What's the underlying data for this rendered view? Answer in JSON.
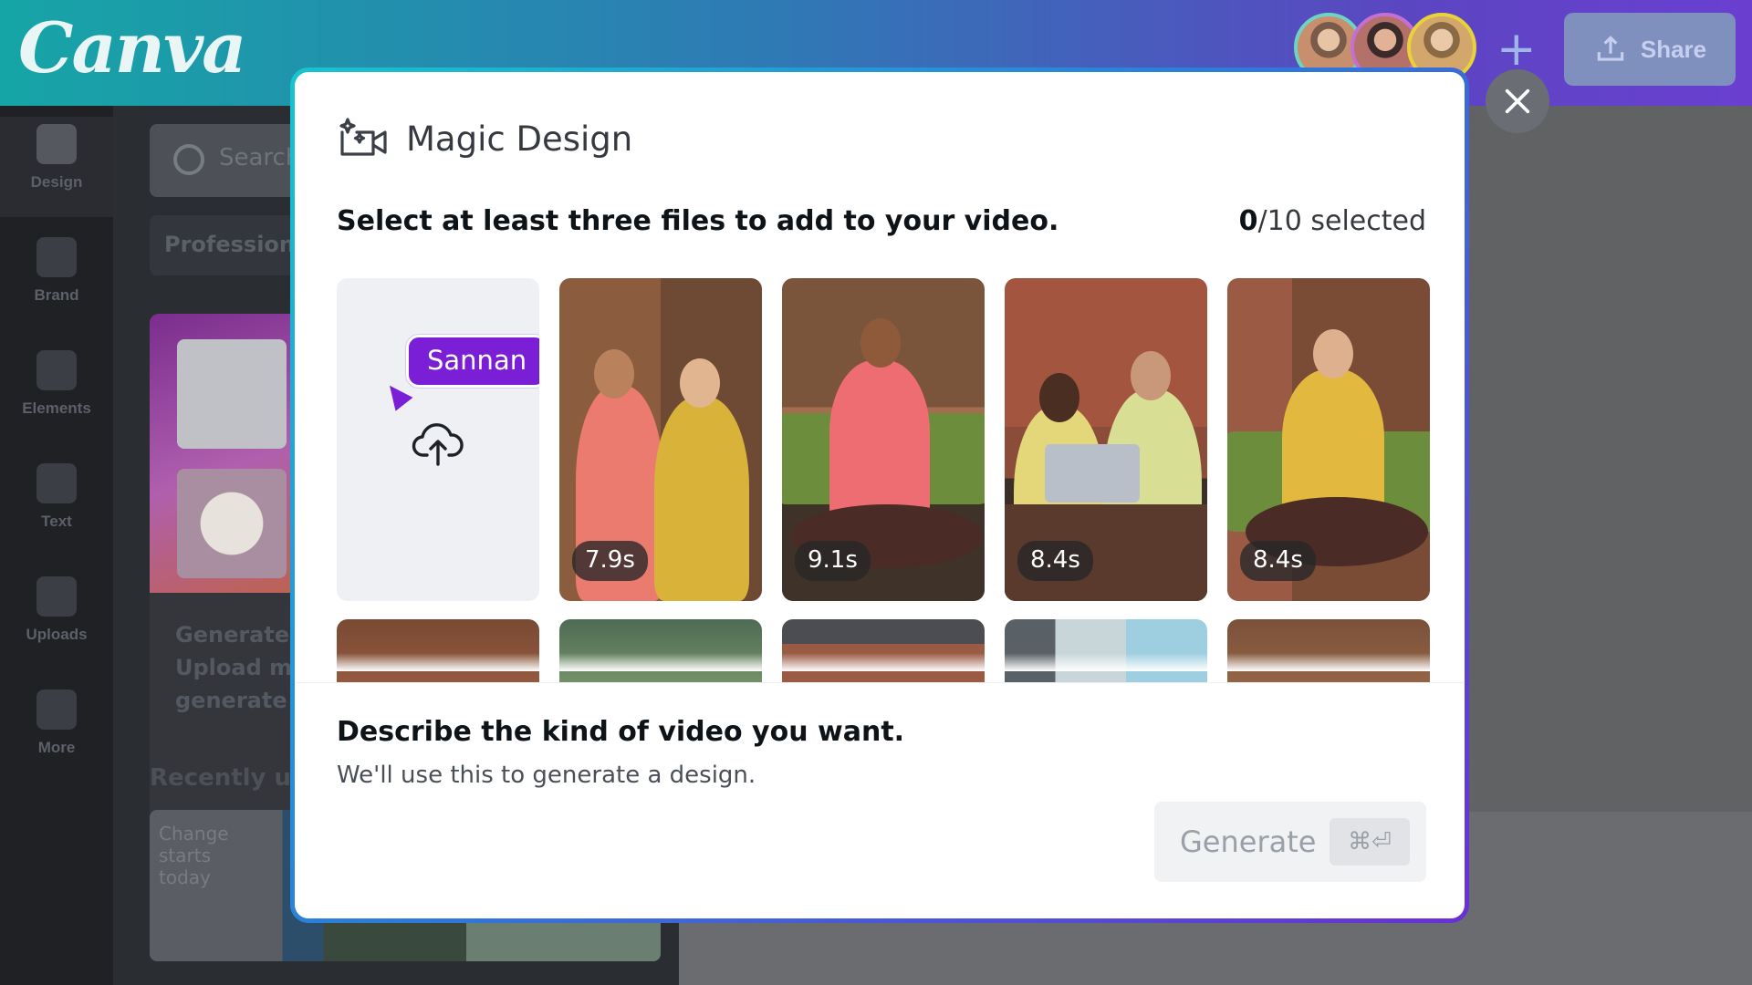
{
  "app": {
    "logo": "Canva",
    "share_label": "Share",
    "add_member_label": "+"
  },
  "rail": {
    "items": [
      {
        "label": "Design",
        "icon": "layout-icon"
      },
      {
        "label": "Brand",
        "icon": "brand-icon"
      },
      {
        "label": "Elements",
        "icon": "elements-icon"
      },
      {
        "label": "Text",
        "icon": "text-icon"
      },
      {
        "label": "Uploads",
        "icon": "upload-icon"
      },
      {
        "label": "More",
        "icon": "more-icon"
      }
    ]
  },
  "panel": {
    "search_placeholder": "Search",
    "chip": "Professional",
    "promo_text": "Generate v Upload med generate vi",
    "recent_label": "Recently use",
    "recent_thumb_text": "Change starts today"
  },
  "modal": {
    "title": "Magic Design",
    "instruction": "Select at least three files to add to your video.",
    "selected_count": "0",
    "selected_total": "/10 selected",
    "collaborator_name": "Sannan",
    "tiles": [
      {
        "duration": "7.9s",
        "scene": "two people looking at phone"
      },
      {
        "duration": "9.1s",
        "scene": "woman on green sofa"
      },
      {
        "duration": "8.4s",
        "scene": "two people at laptop"
      },
      {
        "duration": "8.4s",
        "scene": "man on green sofa"
      }
    ],
    "describe_title": "Describe the kind of video you want.",
    "describe_sub": "We'll use this to generate a design.",
    "generate_label": "Generate",
    "generate_shortcut": "⌘⏎"
  },
  "colors": {
    "accent": "#7b1fd6",
    "modal_border_start": "#18c3cf",
    "modal_border_end": "#6a2fd6"
  }
}
